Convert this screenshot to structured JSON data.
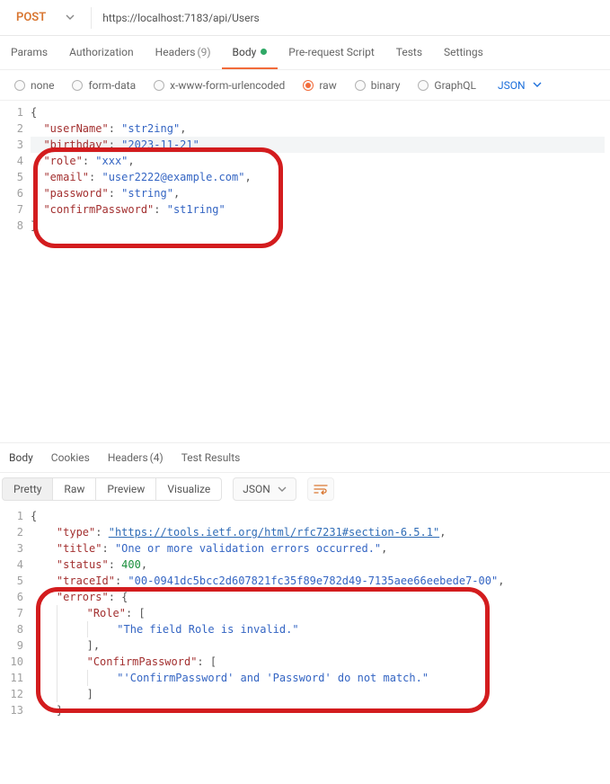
{
  "request": {
    "method": "POST",
    "url": "https://localhost:7183/api/Users",
    "tabs": {
      "params": "Params",
      "auth": "Authorization",
      "headers": "Headers",
      "headers_count": "(9)",
      "body": "Body",
      "prerequest": "Pre-request Script",
      "tests": "Tests",
      "settings": "Settings"
    },
    "bodytypes": {
      "none": "none",
      "formdata": "form-data",
      "xwww": "x-www-form-urlencoded",
      "raw": "raw",
      "binary": "binary",
      "graphql": "GraphQL",
      "json": "JSON"
    },
    "code": {
      "l1": "{",
      "l2k": "\"userName\"",
      "l2v": "\"str2ing\"",
      "l3k": "\"birthday\"",
      "l3v": "\"2023-11-21\"",
      "l4k": "\"role\"",
      "l4v": "\"xxx\"",
      "l5k": "\"email\"",
      "l5v": "\"user2222@example.com\"",
      "l6k": "\"password\"",
      "l6v": "\"string\"",
      "l7k": "\"confirmPassword\"",
      "l7v": "\"st1ring\"",
      "l8": "}"
    }
  },
  "response": {
    "tabs": {
      "body": "Body",
      "cookies": "Cookies",
      "headers": "Headers",
      "headers_count": "(4)",
      "tests": "Test Results"
    },
    "viewmodes": {
      "pretty": "Pretty",
      "raw": "Raw",
      "preview": "Preview",
      "visualize": "Visualize",
      "json": "JSON"
    },
    "code": {
      "l1": "{",
      "l2k": "\"type\"",
      "l2v": "\"https://tools.ietf.org/html/rfc7231#section-6.5.1\"",
      "l3k": "\"title\"",
      "l3v": "\"One or more validation errors occurred.\"",
      "l4k": "\"status\"",
      "l4v": "400",
      "l5k": "\"traceId\"",
      "l5v": "\"00-0941dc5bcc2d607821fc35f89e782d49-7135aee66eebede7-00\"",
      "l6k": "\"errors\"",
      "l7k": "\"Role\"",
      "l8v": "\"The field Role is invalid.\"",
      "l10k": "\"ConfirmPassword\"",
      "l11v": "\"'ConfirmPassword' and 'Password' do not match.\""
    }
  }
}
